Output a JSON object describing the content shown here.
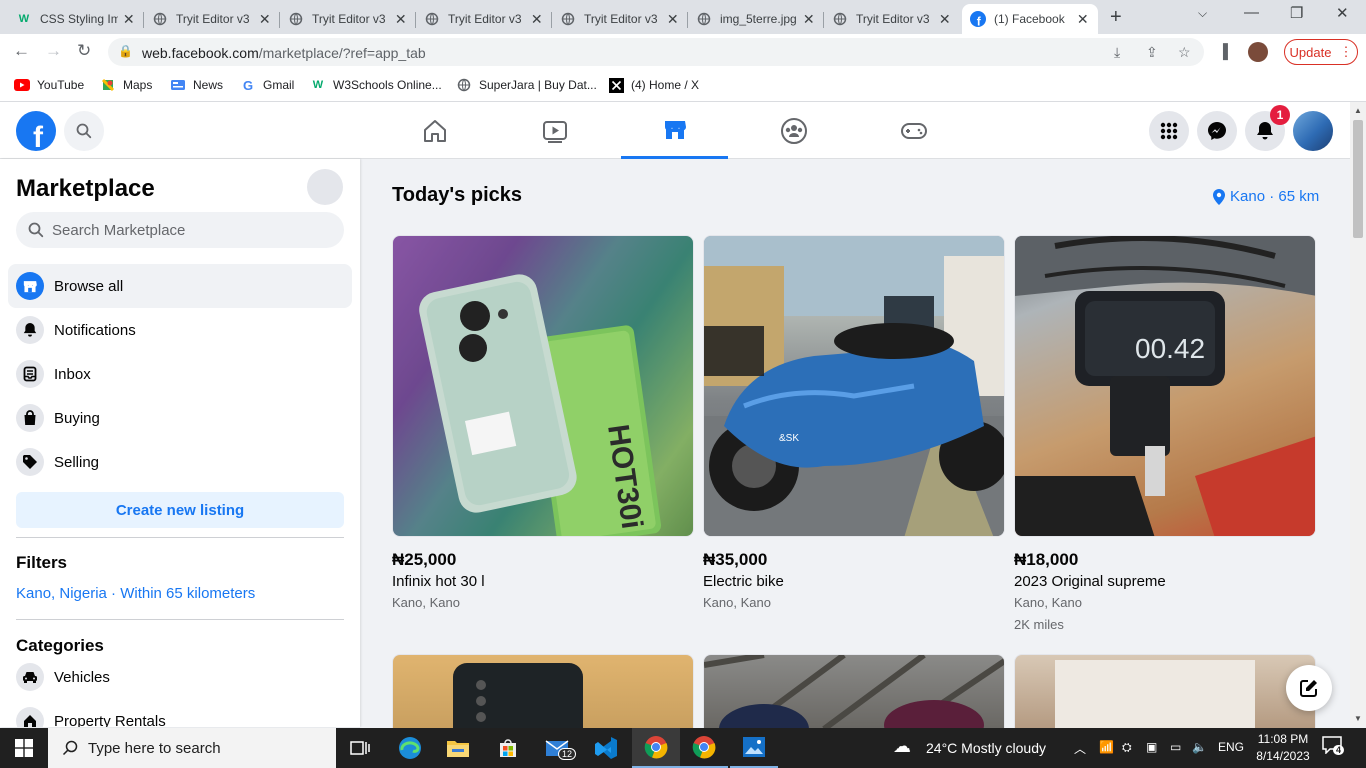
{
  "browser": {
    "tabs": [
      {
        "title": "CSS Styling Im",
        "favicon": "w3schools-icon"
      },
      {
        "title": "Tryit Editor v3",
        "favicon": "globe-icon"
      },
      {
        "title": "Tryit Editor v3",
        "favicon": "globe-icon"
      },
      {
        "title": "Tryit Editor v3",
        "favicon": "globe-icon"
      },
      {
        "title": "Tryit Editor v3",
        "favicon": "globe-icon"
      },
      {
        "title": "img_5terre.jpg",
        "favicon": "globe-icon"
      },
      {
        "title": "Tryit Editor v3",
        "favicon": "globe-icon"
      },
      {
        "title": "(1) Facebook",
        "favicon": "facebook-icon",
        "active": true
      }
    ],
    "url_host": "web.facebook.com",
    "url_path": "/marketplace/?ref=app_tab",
    "update_label": "Update",
    "bookmarks": [
      {
        "label": "YouTube",
        "icon": "youtube-icon"
      },
      {
        "label": "Maps",
        "icon": "maps-icon"
      },
      {
        "label": "News",
        "icon": "news-icon"
      },
      {
        "label": "Gmail",
        "icon": "google-icon"
      },
      {
        "label": "W3Schools Online...",
        "icon": "w3schools-icon"
      },
      {
        "label": "SuperJara | Buy Dat...",
        "icon": "globe-icon"
      },
      {
        "label": "(4) Home / X",
        "icon": "x-icon"
      }
    ]
  },
  "fb": {
    "notification_count": "1",
    "accent": "#1877f2"
  },
  "sidebar": {
    "title": "Marketplace",
    "search_placeholder": "Search Marketplace",
    "items": [
      {
        "label": "Browse all",
        "icon": "storefront-icon"
      },
      {
        "label": "Notifications",
        "icon": "bell-icon"
      },
      {
        "label": "Inbox",
        "icon": "inbox-icon"
      },
      {
        "label": "Buying",
        "icon": "bag-icon"
      },
      {
        "label": "Selling",
        "icon": "tag-icon"
      }
    ],
    "create_label": "Create new listing",
    "filters_heading": "Filters",
    "filter_location": "Kano, Nigeria · Within 65 kilometers",
    "categories_heading": "Categories",
    "categories": [
      {
        "label": "Vehicles",
        "icon": "car-icon"
      },
      {
        "label": "Property Rentals",
        "icon": "house-icon"
      }
    ]
  },
  "main": {
    "heading": "Today's picks",
    "location": "Kano · 65 km",
    "listings": [
      {
        "price": "₦25,000",
        "title": "Infinix hot 30 l",
        "location": "Kano, Kano",
        "extra": ""
      },
      {
        "price": "₦35,000",
        "title": "Electric bike",
        "location": "Kano, Kano",
        "extra": ""
      },
      {
        "price": "₦18,000",
        "title": "2023 Original supreme",
        "location": "Kano, Kano",
        "extra": "2K miles"
      }
    ]
  },
  "taskbar": {
    "search_placeholder": "Type here to search",
    "weather": "24°C  Mostly cloudy",
    "language": "ENG",
    "time": "11:08 PM",
    "date": "8/14/2023",
    "mail_badge": "12",
    "notif_badge": "4"
  }
}
